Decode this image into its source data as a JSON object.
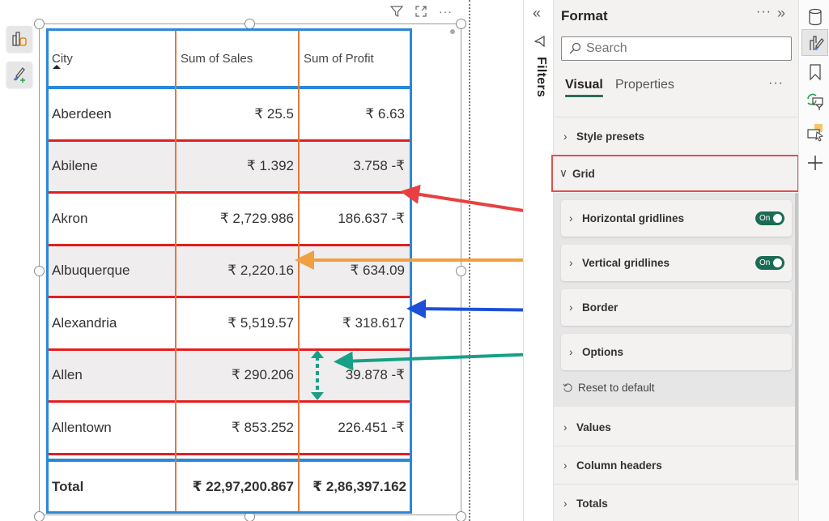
{
  "left_tools": [
    {
      "name": "build-visual",
      "icon": "build-visual-icon"
    },
    {
      "name": "format-visual",
      "icon": "format-brush-icon"
    }
  ],
  "visual_header": {
    "icons": [
      "filter-icon",
      "focus-mode-icon",
      "more-options-icon"
    ],
    "more": "···"
  },
  "table": {
    "columns": [
      "City",
      "Sum of Sales",
      "Sum of Profit"
    ],
    "sort_column": "City",
    "rows": [
      {
        "city": "Aberdeen",
        "sales": "₹ 25.5",
        "profit": "₹ 6.63"
      },
      {
        "city": "Abilene",
        "sales": "₹ 1.392",
        "profit": "3.758 -₹"
      },
      {
        "city": "Akron",
        "sales": "₹ 2,729.986",
        "profit": "186.637 -₹"
      },
      {
        "city": "Albuquerque",
        "sales": "₹ 2,220.16",
        "profit": "₹ 634.09"
      },
      {
        "city": "Alexandria",
        "sales": "₹ 5,519.57",
        "profit": "₹ 318.617"
      },
      {
        "city": "Allen",
        "sales": "₹ 290.206",
        "profit": "39.878 -₹"
      },
      {
        "city": "Allentown",
        "sales": "₹ 853.252",
        "profit": "226.451 -₹"
      }
    ],
    "total": {
      "label": "Total",
      "sales": "₹ 22,97,200.867",
      "profit": "₹ 2,86,397.162"
    },
    "colors": {
      "outer_border": "#2b88d8",
      "horizontal_gridlines": "#e41f1f",
      "vertical_gridlines": "#e07a3b",
      "alt_row": "#efedee"
    }
  },
  "filters": {
    "label": "Filters",
    "collapse": "«"
  },
  "format_pane": {
    "title": "Format",
    "more": "···",
    "collapse": "»",
    "search": {
      "placeholder": "Search",
      "value": ""
    },
    "tabs": [
      {
        "label": "Visual",
        "active": true
      },
      {
        "label": "Properties",
        "active": false
      }
    ],
    "tabs_more": "···",
    "sections": [
      {
        "label": "Style presets",
        "expanded": false
      },
      {
        "label": "Grid",
        "expanded": true,
        "highlighted": true
      },
      {
        "label": "Values",
        "expanded": false
      },
      {
        "label": "Column headers",
        "expanded": false
      },
      {
        "label": "Totals",
        "expanded": false
      }
    ],
    "grid_cards": [
      {
        "label": "Horizontal gridlines",
        "toggle": "On",
        "toggle_on": true
      },
      {
        "label": "Vertical gridlines",
        "toggle": "On",
        "toggle_on": true
      },
      {
        "label": "Border"
      },
      {
        "label": "Options"
      }
    ],
    "reset": "Reset to default",
    "accent": "#1c6b55"
  },
  "right_rail": {
    "icons": [
      "data-icon",
      "format-visual-icon",
      "bookmark-icon",
      "sync-slicers-icon",
      "selection-icon",
      "add-icon"
    ],
    "active": "format-visual-icon"
  },
  "annotations": [
    {
      "color": "#e84040",
      "from": "Horizontal gridlines",
      "to": "horizontal gridline"
    },
    {
      "color": "#f0a040",
      "from": "Vertical gridlines",
      "to": "vertical gridline"
    },
    {
      "color": "#1e4fd8",
      "from": "Border",
      "to": "table border"
    },
    {
      "color": "#17a085",
      "from": "Options",
      "to": "row padding"
    }
  ]
}
